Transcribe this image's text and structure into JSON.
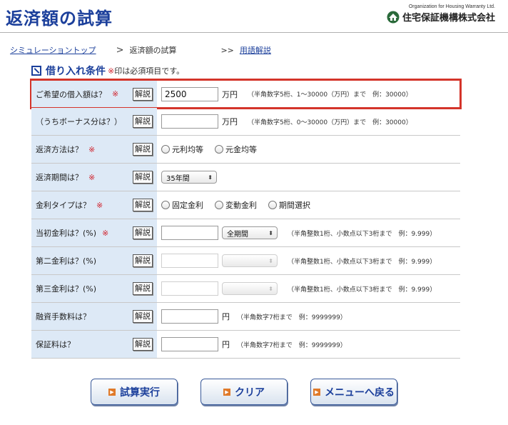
{
  "header": {
    "title": "返済額の試算",
    "org_en": "Organization for Housing Warranty Ltd.",
    "org_jp": "住宅保証機構株式会社"
  },
  "breadcrumb": {
    "top_link": "シミュレーショントップ",
    "separator": ">",
    "current": "返済額の試算",
    "arrow": ">>",
    "glossary_link": "用語解説"
  },
  "section": {
    "title": "借り入れ条件",
    "note_mark": "※",
    "note_text": "印は必須項目です。"
  },
  "common": {
    "kaisetsu": "解説",
    "required_mark": "※"
  },
  "rows": {
    "loan_amount": {
      "label": "ご希望の借入額は？",
      "value": "2500",
      "unit": "万円",
      "hint": "（半角数字5桁、1〜30000（万円）まで　例：30000）"
    },
    "bonus": {
      "label": "（うちボーナス分は？）",
      "value": "",
      "unit": "万円",
      "hint": "（半角数字5桁、0〜30000（万円）まで　例：30000）"
    },
    "repay_method": {
      "label": "返済方法は？",
      "options": [
        "元利均等",
        "元金均等"
      ]
    },
    "repay_period": {
      "label": "返済期間は？",
      "selected": "35年間"
    },
    "rate_type": {
      "label": "金利タイプは？",
      "options": [
        "固定金利",
        "変動金利",
        "期間選択"
      ]
    },
    "rate1": {
      "label": "当初金利は？(%)",
      "value": "",
      "period": "全期間",
      "hint": "（半角整数1桁、小数点以下3桁まで　例：9.999）"
    },
    "rate2": {
      "label": "第二金利は？(%)",
      "value": "",
      "period": "",
      "hint": "（半角整数1桁、小数点以下3桁まで　例：9.999）"
    },
    "rate3": {
      "label": "第三金利は？(%)",
      "value": "",
      "period": "",
      "hint": "（半角整数1桁、小数点以下3桁まで　例：9.999）"
    },
    "fee": {
      "label": "融資手数料は？",
      "value": "",
      "unit": "円",
      "hint": "（半角数字7桁まで　例：9999999）"
    },
    "guarantee": {
      "label": "保証料は？",
      "value": "",
      "unit": "円",
      "hint": "（半角数字7桁まで　例：9999999）"
    }
  },
  "buttons": {
    "calculate": "試算実行",
    "clear": "クリア",
    "back": "メニューへ戻る"
  },
  "colors": {
    "brand": "#1b3f9b",
    "required": "#d0202a",
    "label_bg": "#dde9f6",
    "highlight": "#d4342a",
    "button_icon": "#e07a2a"
  }
}
